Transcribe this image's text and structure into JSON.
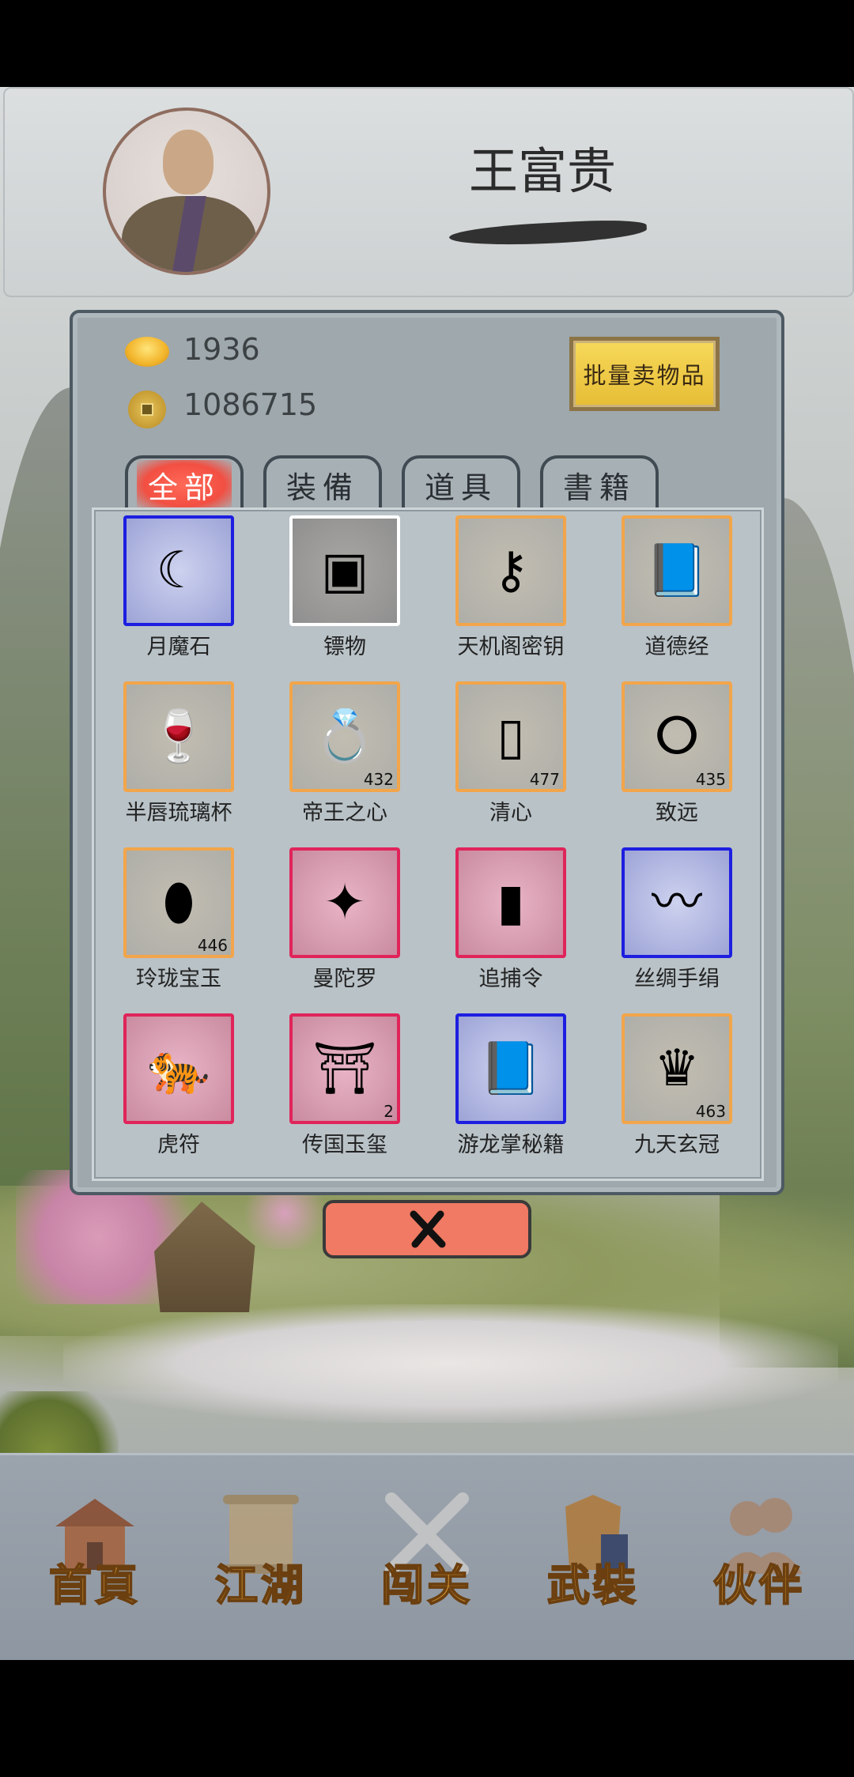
{
  "player": {
    "name": "王富贵"
  },
  "currency": {
    "gold": "1936",
    "coins": "1086715"
  },
  "sell_button": "批量卖物品",
  "tabs": [
    {
      "label": "全部",
      "active": true
    },
    {
      "label": "装備",
      "active": false
    },
    {
      "label": "道具",
      "active": false
    },
    {
      "label": "書籍",
      "active": false
    }
  ],
  "items": [
    {
      "name": "月魔石",
      "rarity": "blue",
      "icon": "crescent-moon-icon",
      "glyph": "☾",
      "qty": ""
    },
    {
      "name": "镖物",
      "rarity": "white",
      "icon": "crate-icon",
      "glyph": "▣",
      "qty": ""
    },
    {
      "name": "天机阁密钥",
      "rarity": "orange",
      "icon": "key-icon",
      "glyph": "⚷",
      "qty": ""
    },
    {
      "name": "道德经",
      "rarity": "orange",
      "icon": "book-icon",
      "glyph": "📘",
      "qty": ""
    },
    {
      "name": "半唇琉璃杯",
      "rarity": "orange",
      "icon": "goblet-icon",
      "glyph": "🍷",
      "qty": ""
    },
    {
      "name": "帝王之心",
      "rarity": "orange",
      "icon": "ring-icon",
      "glyph": "💍",
      "qty": "432"
    },
    {
      "name": "清心",
      "rarity": "orange",
      "icon": "jade-bracelet-icon",
      "glyph": "▯",
      "qty": "477"
    },
    {
      "name": "致远",
      "rarity": "orange",
      "icon": "pendant-icon",
      "glyph": "ⵔ",
      "qty": "435"
    },
    {
      "name": "玲珑宝玉",
      "rarity": "orange",
      "icon": "jade-icon",
      "glyph": "⬮",
      "qty": "446"
    },
    {
      "name": "曼陀罗",
      "rarity": "red",
      "icon": "flower-icon",
      "glyph": "✦",
      "qty": ""
    },
    {
      "name": "追捕令",
      "rarity": "red",
      "icon": "token-icon",
      "glyph": "▮",
      "qty": ""
    },
    {
      "name": "丝绸手绢",
      "rarity": "blue",
      "icon": "silk-icon",
      "glyph": "〰",
      "qty": ""
    },
    {
      "name": "虎符",
      "rarity": "red",
      "icon": "tiger-tally-icon",
      "glyph": "🐅",
      "qty": ""
    },
    {
      "name": "传国玉玺",
      "rarity": "red",
      "icon": "imperial-seal-icon",
      "glyph": "⛩",
      "qty": "2"
    },
    {
      "name": "游龙掌秘籍",
      "rarity": "blue",
      "icon": "book-icon",
      "glyph": "📘",
      "qty": ""
    },
    {
      "name": "九天玄冠",
      "rarity": "orange",
      "icon": "crown-icon",
      "glyph": "♛",
      "qty": "463"
    }
  ],
  "close_icon": "close-icon",
  "nav": [
    {
      "label": "首頁",
      "icon": "house-icon"
    },
    {
      "label": "江湖",
      "icon": "scroll-icon"
    },
    {
      "label": "闯关",
      "icon": "crossed-swords-icon"
    },
    {
      "label": "武裝",
      "icon": "armor-icon"
    },
    {
      "label": "伙伴",
      "icon": "companions-icon"
    }
  ],
  "colors": {
    "rarity_orange": "#f2a54a",
    "rarity_blue": "#1d1ee0",
    "rarity_red": "#e0245a",
    "rarity_white": "#ffffff",
    "accent_tab": "#f24f42",
    "sell_button": "#f7d95a",
    "close_button": "#f07a63"
  }
}
